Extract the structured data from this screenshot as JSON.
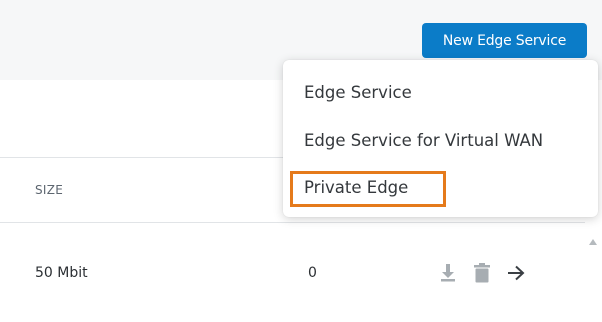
{
  "header": {
    "new_button_label": "New Edge Service"
  },
  "table": {
    "columns": {
      "size": "SIZE"
    },
    "rows": [
      {
        "size": "50 Mbit",
        "count": "0"
      }
    ]
  },
  "dropdown": {
    "items": [
      {
        "label": "Edge Service"
      },
      {
        "label": "Edge Service for Virtual WAN"
      },
      {
        "label": "Private Edge",
        "highlighted": true
      }
    ]
  },
  "colors": {
    "primary_button": "#0b7cc8",
    "highlight_outline": "#e57a1b",
    "icon_gray": "#a7adb2"
  },
  "icons": [
    "download-icon",
    "trash-icon",
    "arrow-right-icon",
    "scroll-up-arrow-icon"
  ]
}
